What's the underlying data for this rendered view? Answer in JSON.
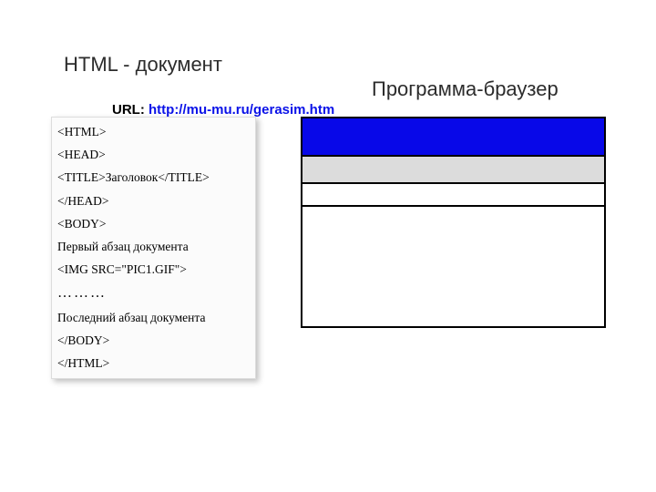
{
  "headings": {
    "left": "HTML - документ",
    "right": "Программа-браузер"
  },
  "url": {
    "label": "URL:",
    "value": "http://mu-mu.ru/gerasim.htm"
  },
  "code": {
    "lines": [
      "<HTML>",
      "<HEAD>",
      "<TITLE>Заголовок</TITLE>",
      "</HEAD>",
      "<BODY>",
      "Первый абзац документа",
      "<IMG SRC=\"PIC1.GIF\">",
      "………",
      "Последний абзац документа",
      "</BODY>",
      "</HTML>"
    ]
  }
}
